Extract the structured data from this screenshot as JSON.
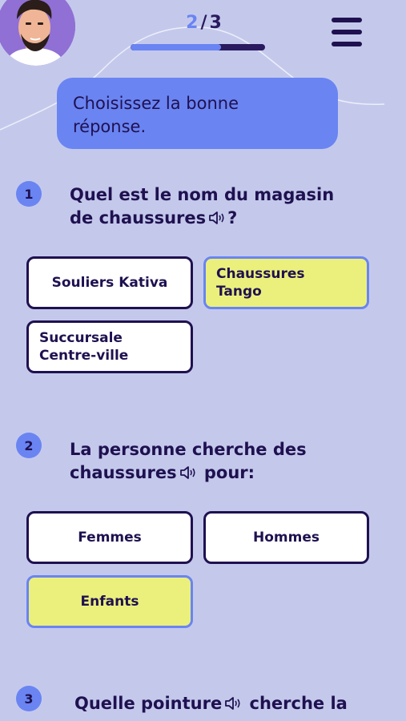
{
  "header": {
    "progress_current": "2",
    "progress_separator": "/",
    "progress_total": "3",
    "progress_fraction": 0.67
  },
  "instruction": {
    "line1": "Choisissez la bonne",
    "line2": "réponse."
  },
  "questions": [
    {
      "number": "1",
      "line1": "Quel est le nom du magasin",
      "line2_before_audio": "de chaussures",
      "line2_after_audio": "?",
      "options": [
        {
          "label": "Souliers Kativa",
          "selected": false
        },
        {
          "label_line1": "Chaussures",
          "label_line2": "Tango",
          "selected": true
        },
        {
          "label_line1": "Succursale",
          "label_line2": "Centre-ville",
          "selected": false
        }
      ]
    },
    {
      "number": "2",
      "line1": "La personne cherche des",
      "line2_before_audio": "chaussures",
      "line2_after_audio": "pour:",
      "options": [
        {
          "label": "Femmes",
          "selected": false
        },
        {
          "label": "Hommes",
          "selected": false
        },
        {
          "label": "Enfants",
          "selected": true
        }
      ]
    },
    {
      "number": "3",
      "line1_before_audio": "Quelle pointure",
      "line1_after_audio": "cherche la"
    }
  ],
  "icons": {
    "avatar": "user-avatar",
    "menu": "hamburger-menu-icon",
    "audio": "speaker-audio-icon"
  },
  "colors": {
    "background": "#c4c9ec",
    "accent_blue": "#6a84f2",
    "dark_navy": "#1f1150",
    "selected_yellow": "#ebf07c"
  }
}
